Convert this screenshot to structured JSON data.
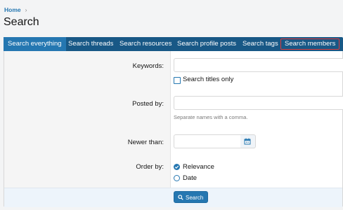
{
  "breadcrumb": {
    "home": "Home",
    "separator": "›"
  },
  "page": {
    "title": "Search"
  },
  "tabs": [
    {
      "label": "Search everything",
      "active": true
    },
    {
      "label": "Search threads"
    },
    {
      "label": "Search resources"
    },
    {
      "label": "Search profile posts"
    },
    {
      "label": "Search tags"
    },
    {
      "label": "Search members",
      "highlighted": true
    }
  ],
  "form": {
    "keywords": {
      "label": "Keywords:",
      "value": "",
      "titles_only_label": "Search titles only"
    },
    "posted_by": {
      "label": "Posted by:",
      "value": "",
      "hint": "Separate names with a comma."
    },
    "newer_than": {
      "label": "Newer than:",
      "value": ""
    },
    "order_by": {
      "label": "Order by:",
      "options": [
        "Relevance",
        "Date"
      ],
      "selected": "Relevance"
    },
    "submit_label": "Search"
  },
  "colors": {
    "accent": "#2577b1",
    "tab_bar": "#185886",
    "highlight_border": "#e03a3a"
  }
}
